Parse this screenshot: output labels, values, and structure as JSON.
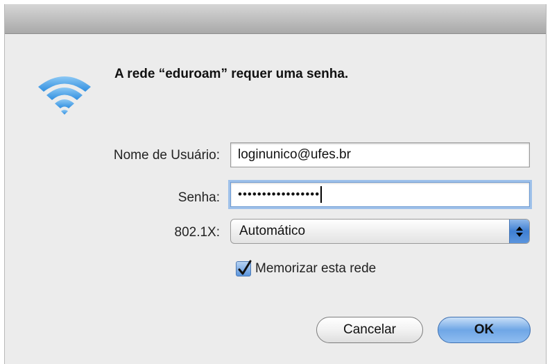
{
  "dialog": {
    "heading": "A rede “eduroam” requer uma senha."
  },
  "form": {
    "username": {
      "label": "Nome de Usuário:",
      "value": "loginunico@ufes.br"
    },
    "password": {
      "label": "Senha:",
      "value_masked": "•••••••••••••••••"
    },
    "security": {
      "label": "802.1X:",
      "selected": "Automático"
    },
    "remember": {
      "label": "Memorizar esta rede",
      "checked": true
    }
  },
  "buttons": {
    "cancel_label": "Cancelar",
    "ok_label": "OK"
  },
  "icons": {
    "network": "wifi-icon"
  },
  "colors": {
    "accent": "#3f7fd3",
    "wifi": "#3a97e6"
  }
}
